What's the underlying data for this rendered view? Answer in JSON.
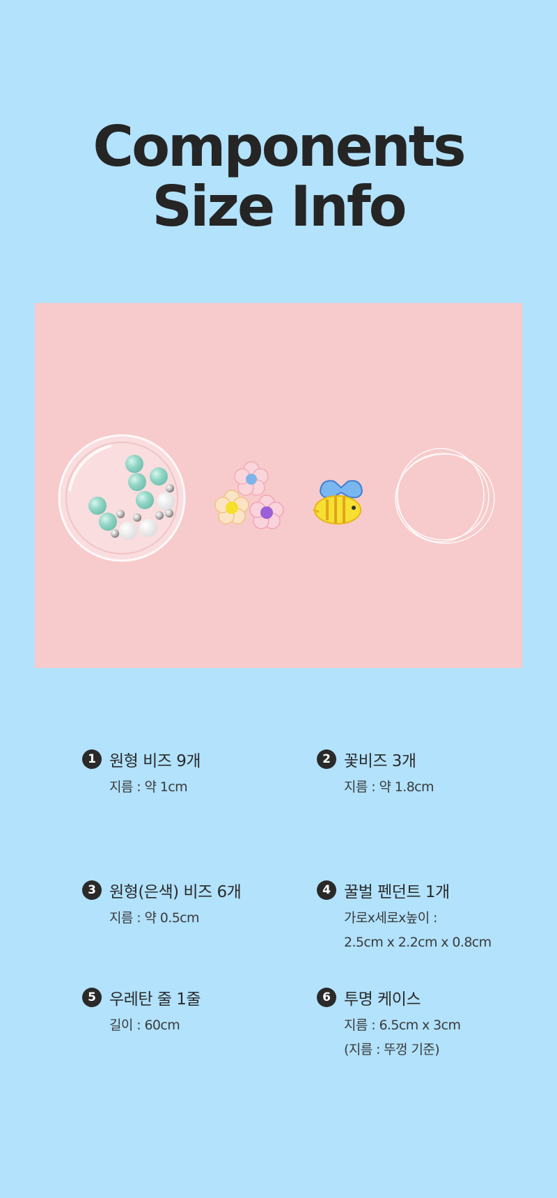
{
  "header": {
    "title_line1": "Components",
    "title_line2": "Size Info"
  },
  "photo": {
    "background_color": "#f7cacb",
    "contents": [
      "round beads in clear case",
      "flower beads",
      "bee pendant",
      "urethane string"
    ]
  },
  "items": [
    {
      "number": "1",
      "name": "원형 비즈 9개",
      "details": [
        "지름 : 약 1cm"
      ]
    },
    {
      "number": "2",
      "name": "꽃비즈 3개",
      "details": [
        "지름 : 약 1.8cm"
      ]
    },
    {
      "number": "3",
      "name": "원형(은색) 비즈 6개",
      "details": [
        "지름 : 약 0.5cm"
      ]
    },
    {
      "number": "4",
      "name": "꿀벌 펜던트 1개",
      "details": [
        "가로x세로x높이 :",
        "2.5cm x 2.2cm x 0.8cm"
      ]
    },
    {
      "number": "5",
      "name": "우레탄 줄 1줄",
      "details": [
        "길이 : 60cm"
      ]
    },
    {
      "number": "6",
      "name": "투명 케이스",
      "details": [
        "지름 : 6.5cm x 3cm",
        "(지름 : 뚜껑 기준)"
      ]
    }
  ],
  "colors": {
    "page_background": "#b2e2fc",
    "text": "#2a2a2a",
    "badge": "#2a2a2a"
  }
}
